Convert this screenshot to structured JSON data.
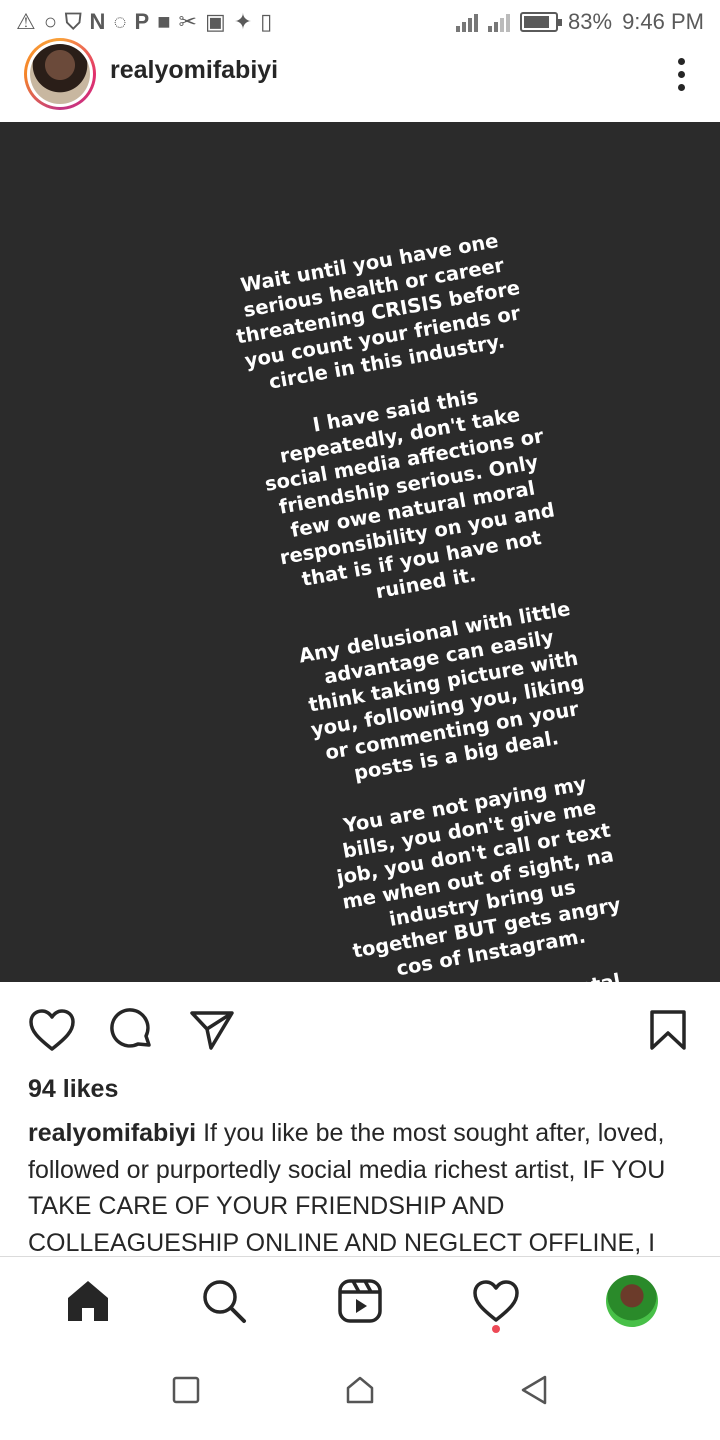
{
  "status_bar": {
    "battery_percent": "83%",
    "battery_level": 0.83,
    "time": "9:46 PM",
    "left_icons": [
      "warning-icon",
      "chat-bubble-icon",
      "shield-icon",
      "n-icon",
      "whatsapp-icon",
      "p-icon",
      "square-icon",
      "scissors-icon",
      "image-icon",
      "twitter-icon",
      "phone-icon"
    ],
    "left_glyphs": [
      "⚠",
      "○",
      "⛉",
      "N",
      "◌",
      "P",
      "■",
      "✂",
      "▣",
      "✦",
      "▯"
    ]
  },
  "post": {
    "username": "realyomifabiyi",
    "story_paragraphs": [
      "Wait until you have one\nserious health or career\nthreatening CRISIS before\nyou count your friends or\ncircle in this industry.",
      "I have said this\nrepeatedly, don't take\nsocial media affections or\nfriendship serious. Only\nfew owe natural moral\nresponsibility on you and\nthat is if you have not\nruined it.",
      "Any delusional with little\nadvantage can easily\nthink taking picture with\nyou, following you, liking\nor commenting on your\nposts is a big deal.",
      "You are not paying my\nbills, you don't give me\njob, you don't call or text\nme when out of sight, na\nindustry  bring us\ntogether BUT gets angry\ncos of Instagram.",
      "That is serious mental\nSICKNESS. Social Media\nis majorly for your fans\nand externals."
    ],
    "likes": "94 likes",
    "caption_user": "realyomifabiyi",
    "caption_text": " If you like be the most sought after, loved, followed or purportedly social media richest artist, IF YOU TAKE CARE OF YOUR FRIENDSHIP AND COLLEAGUESHIP ONLINE AND NEGLECT OFFLINE, I"
  },
  "colors": {
    "story_bg": "#2b2b2b",
    "text": "#262626",
    "notification_dot": "#ed4956"
  }
}
